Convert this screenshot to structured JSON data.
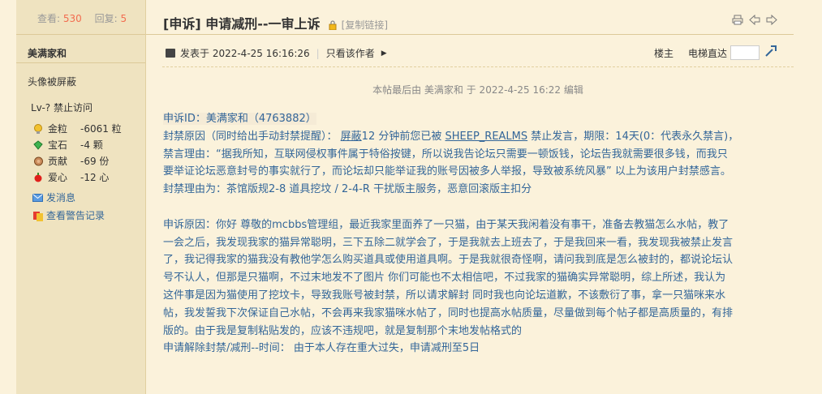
{
  "sidebar": {
    "views_label": "查看:",
    "views_value": "530",
    "replies_label": "回复:",
    "replies_value": "5",
    "author_name": "美满家和",
    "avatar_note": "头像被屏蔽",
    "level": "Lv-? 禁止访问",
    "credits": [
      {
        "icon": "gold-icon",
        "label": "金粒",
        "value": "-6061 粒"
      },
      {
        "icon": "gem-icon",
        "label": "宝石",
        "value": "-4 颗"
      },
      {
        "icon": "contribution-icon",
        "label": "贡献",
        "value": "-69 份"
      },
      {
        "icon": "heart-icon",
        "label": "爱心",
        "value": "-12 心"
      }
    ],
    "actions": [
      {
        "icon": "message-icon",
        "label": "发消息"
      },
      {
        "icon": "warning-icon",
        "label": "查看警告记录"
      }
    ]
  },
  "thread": {
    "title": "[申诉] 申请减刑--一审上诉",
    "copy_link": "[复制链接]"
  },
  "meta": {
    "posted": "发表于 2022-4-25 16:16:26",
    "only_author": "只看该作者",
    "floor_label": "楼主",
    "jump_label": "电梯直达"
  },
  "post": {
    "edited": "本帖最后由 美满家和 于 2022-4-25 16:22 编辑",
    "line1": "申诉ID：美满家和（4763882）",
    "line2_prefix": "封禁原因（同时给出手动封禁提醒）：",
    "line2_link1": "屏蔽",
    "line2_mid": "12 分钟前您已被",
    "line2_link2": "SHEEP_REALMS",
    "line2_suffix": "禁止发言，期限：14天(0：代表永久禁言)，",
    "line3": "禁言理由：“据我所知，互联网侵权事件属于特俗按键，所以说我告论坛只需要一顿饭钱，论坛告我就需要很多钱，而我只",
    "line4": "要举证论坛恶意封号的事实就行了，而论坛却只能举证我的账号因被多人举报，导致被系统风暴” 以上为该用户封禁感言。",
    "line5": "封禁理由为：茶馆版规2-8 道具挖坟 / 2-4-R 干扰版主服务，恶意回滚版主扣分",
    "p2_l1": "申诉原因：你好 尊敬的mcbbs管理组，最近我家里面养了一只猫，由于某天我闲着没有事干，准备去教猫怎么水帖，教了",
    "p2_l2": "一会之后，我发现我家的猫异常聪明，三下五除二就学会了，于是我就去上班去了，于是我回来一看，我发现我被禁止发言",
    "p2_l3": "了，我记得我家的猫我没有教他学怎么购买道具或使用道具啊。于是我就很奇怪啊，请问我到底是怎么被封的，都说论坛认",
    "p2_l4": "号不认人，但那是只猫啊，不过末地发不了图片 你们可能也不太相信吧，不过我家的猫确实异常聪明，综上所述，我认为",
    "p2_l5": "这件事是因为猫使用了挖坟卡，导致我账号被封禁，所以请求解封 同时我也向论坛道歉，不该敷衍了事，拿一只猫咪来水",
    "p2_l6": "帖，我发誓我下次保证自己水帖，不会再来我家猫咪水帖了，同时也提高水帖质量，尽量做到每个帖子都是高质量的，有排",
    "p2_l7": "版的。由于我是复制粘贴发的，应该不违规吧，就是复制那个末地发帖格式的",
    "p3": "申请解除封禁/减刑--时间：  由于本人存在重大过失，申请减刑至5日"
  },
  "colors": {
    "page_bg": "#fbf2db",
    "sidebar_bg": "#efe3c0",
    "link_blue": "#336699",
    "count_red": "#f26c4f"
  }
}
